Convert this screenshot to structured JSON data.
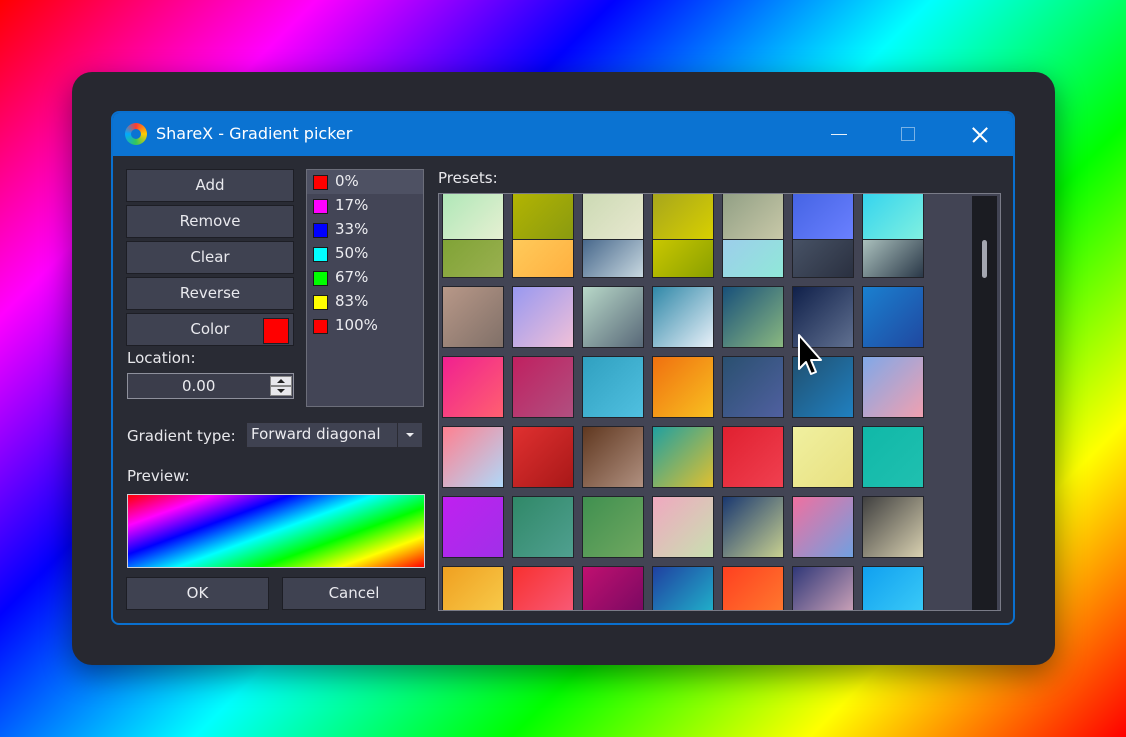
{
  "window": {
    "title": "ShareX - Gradient picker",
    "title_bar_color": "#0b73d2"
  },
  "buttons": {
    "add": "Add",
    "remove": "Remove",
    "clear": "Clear",
    "reverse": "Reverse",
    "color": "Color",
    "ok": "OK",
    "cancel": "Cancel"
  },
  "selected_color": "#ff0000",
  "stops": [
    {
      "label": "0%",
      "color": "#ff0000",
      "selected": true
    },
    {
      "label": "17%",
      "color": "#ff00ff",
      "selected": false
    },
    {
      "label": "33%",
      "color": "#0000ff",
      "selected": false
    },
    {
      "label": "50%",
      "color": "#00ffff",
      "selected": false
    },
    {
      "label": "67%",
      "color": "#00ff00",
      "selected": false
    },
    {
      "label": "83%",
      "color": "#ffff00",
      "selected": false
    },
    {
      "label": "100%",
      "color": "#ff0000",
      "selected": false
    }
  ],
  "location": {
    "label": "Location:",
    "value": "0.00"
  },
  "gradient_type": {
    "label": "Gradient type:",
    "value": "Forward diagonal"
  },
  "preview": {
    "label": "Preview:"
  },
  "presets": {
    "label": "Presets:",
    "rows": [
      [
        [
          "#a8e6b4",
          "#e6f0d2"
        ],
        [
          "#b8b800",
          "#8a9a10"
        ],
        [
          "#c8d8b0",
          "#e8e8d0"
        ],
        [
          "#a0a020",
          "#d8d000"
        ],
        [
          "#8a9a80",
          "#c8c8a8"
        ],
        [
          "#4060e0",
          "#6a80ff"
        ],
        [
          "#2ad0f0",
          "#80f0e0"
        ]
      ],
      [
        [
          "#7aa030",
          "#9ab050"
        ],
        [
          "#ffd060",
          "#ffb040"
        ],
        [
          "#2a4e78",
          "#c8d8e0"
        ],
        [
          "#d8d000",
          "#8aa000"
        ],
        [
          "#a0c8f0",
          "#90e8d8"
        ],
        [
          "#4e5a6e",
          "#2a3040"
        ],
        [
          "#c8e0d8",
          "#2a3848"
        ]
      ],
      [
        [
          "#b89888",
          "#807068"
        ],
        [
          "#9898f0",
          "#f0c0d8"
        ],
        [
          "#b8d8c8",
          "#586878"
        ],
        [
          "#3088a8",
          "#e8f0f8"
        ],
        [
          "#18507a",
          "#8ab880"
        ],
        [
          "#10204a",
          "#607090"
        ],
        [
          "#1a80d0",
          "#2048a0"
        ]
      ],
      [
        [
          "#f02090",
          "#ff6070"
        ],
        [
          "#c02060",
          "#b05080"
        ],
        [
          "#30a0c0",
          "#50c0e0"
        ],
        [
          "#f07010",
          "#f8c020"
        ],
        [
          "#2a5070",
          "#5060a0"
        ],
        [
          "#205070",
          "#2080c0"
        ],
        [
          "#80a8e8",
          "#f0a0b0"
        ]
      ],
      [
        [
          "#ff8090",
          "#b0d8f8"
        ],
        [
          "#e03030",
          "#a81818"
        ],
        [
          "#603820",
          "#b09080"
        ],
        [
          "#20a0a0",
          "#e0c030"
        ],
        [
          "#e02030",
          "#f04050"
        ],
        [
          "#f0f0a0",
          "#e8e080"
        ],
        [
          "#10b8a8",
          "#20c0b0"
        ]
      ],
      [
        [
          "#c020f0",
          "#a030e8"
        ],
        [
          "#308868",
          "#50a090"
        ],
        [
          "#409050",
          "#70a860"
        ],
        [
          "#f0a8c0",
          "#c8e0b0"
        ],
        [
          "#1a3870",
          "#c8d090"
        ],
        [
          "#f070a0",
          "#70a0e0"
        ],
        [
          "#404040",
          "#d8d0b0"
        ]
      ],
      [
        [
          "#f0a020",
          "#f8d050"
        ],
        [
          "#f83030",
          "#f86080"
        ],
        [
          "#c01070",
          "#700860"
        ],
        [
          "#2040a0",
          "#20c0d0"
        ],
        [
          "#ff4020",
          "#ff8030"
        ],
        [
          "#303878",
          "#e0b0c0"
        ],
        [
          "#10a0f0",
          "#40d0f8"
        ]
      ]
    ]
  }
}
